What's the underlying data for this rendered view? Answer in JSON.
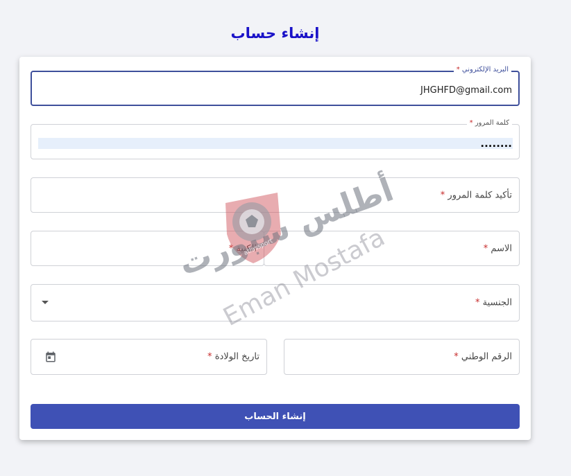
{
  "page": {
    "title": "إنشاء حساب"
  },
  "form": {
    "email": {
      "label": "البريد الإلكتروني",
      "required_mark": "*",
      "value": "JHGHFD@gmail.com"
    },
    "password": {
      "label": "كلمة المرور",
      "required_mark": "*",
      "value": "........"
    },
    "confirm_password": {
      "label": "تأكيد كلمة المرور",
      "required_mark": "*"
    },
    "first_name": {
      "label": "الاسم",
      "required_mark": "*"
    },
    "last_name": {
      "label": "الكنية",
      "required_mark": "*"
    },
    "nationality": {
      "label": "الجنسية",
      "required_mark": "*"
    },
    "national_id": {
      "label": "الرقم الوطني",
      "required_mark": "*"
    },
    "birth_date": {
      "label": "تاريخ الولادة",
      "required_mark": "*"
    },
    "submit_label": "إنشاء الحساب"
  },
  "watermark": {
    "brand_text": "أطلس سبورت",
    "logo_text": "atlassport",
    "author_text": "Eman Mostafa"
  },
  "colors": {
    "title": "#1a12c8",
    "accent": "#3f51b5",
    "required": "#c62828",
    "focus_border": "#3e4f9b"
  },
  "icons": {
    "nationality": "dropdown-arrow-icon",
    "birth_date": "calendar-icon"
  }
}
